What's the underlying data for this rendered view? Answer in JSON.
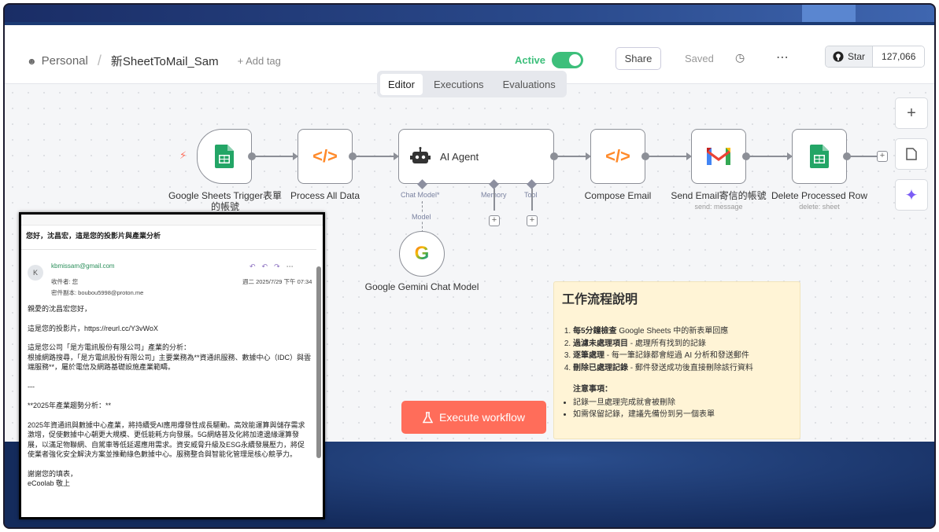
{
  "header": {
    "personal": "Personal",
    "workflow_name": "新SheetToMail_Sam",
    "add_tag": "+ Add tag",
    "active_label": "Active",
    "share": "Share",
    "saved": "Saved",
    "github_star": "Star",
    "github_count": "127,066"
  },
  "tabs": [
    "Editor",
    "Executions",
    "Evaluations"
  ],
  "nodes": {
    "trigger": {
      "label": "Google Sheets Trigger表單的帳號"
    },
    "process": {
      "label": "Process All Data"
    },
    "agent": {
      "label": "AI Agent",
      "chat_model": "Chat Model*",
      "memory": "Memory",
      "tool": "Tool"
    },
    "compose": {
      "label": "Compose Email"
    },
    "send": {
      "label": "Send Email寄信的帳號",
      "sub": "send: message"
    },
    "delete": {
      "label": "Delete Processed Row",
      "sub": "delete: sheet"
    },
    "gemini": {
      "label": "Google Gemini Chat Model",
      "edge_label": "Model"
    }
  },
  "note": {
    "title": "工作流程說明",
    "steps": [
      {
        "bold": "每5分鐘檢查",
        "text": " Google Sheets 中的新表單回應"
      },
      {
        "bold": "過濾未處理項目",
        "text": " - 處理所有找到的記錄"
      },
      {
        "bold": "逐筆處理",
        "text": " - 每一筆記錄都會經過 AI 分析和發送郵件"
      },
      {
        "bold": "刪除已處理記錄",
        "text": " - 郵件發送成功後直接刪除該行資料"
      }
    ],
    "warn_title": "注意事項：",
    "warn_items": [
      "記錄一旦處理完成就會被刪除",
      "如需保留記錄，建議先備份到另一個表單"
    ]
  },
  "execute_button": "Execute workflow",
  "mail": {
    "subject": "您好，沈昌宏，這是您的投影片與產業分析",
    "avatar": "K",
    "from": "kbmissam@gmail.com",
    "to": "收件者: 您",
    "date": "週二 2025/7/29 下午 07:34",
    "bcc": "密件副本: boubou5998@proton.me",
    "body": [
      "親愛的沈昌宏您好，",
      "這是您的投影片，https://reurl.cc/Y3vWoX",
      "這是您公司「是方電訊股份有限公司」產業的分析：\n根據網路搜尋，「是方電訊股份有限公司」主要業務為**資通訊服務、數據中心（IDC）與雲端服務**，屬於電信及網路基礎設施產業範疇。",
      "---",
      "**2025年產業趨勢分析：**",
      "2025年資通訊與數據中心產業，將持續受AI應用爆發性成長驅動。高效能運算與儲存需求激增，促使數據中心朝更大規模、更低能耗方向發展。5G網絡普及化將加速邊緣運算發展，以滿足物聯網、自駕車等低延遲應用需求。資安威脅升級及ESG永續發展壓力，將促使業者強化安全解決方案並推動綠色數據中心。服務整合與智能化管理是核心競爭力。",
      "謝謝您的填表，\neCoolab 敬上"
    ]
  }
}
